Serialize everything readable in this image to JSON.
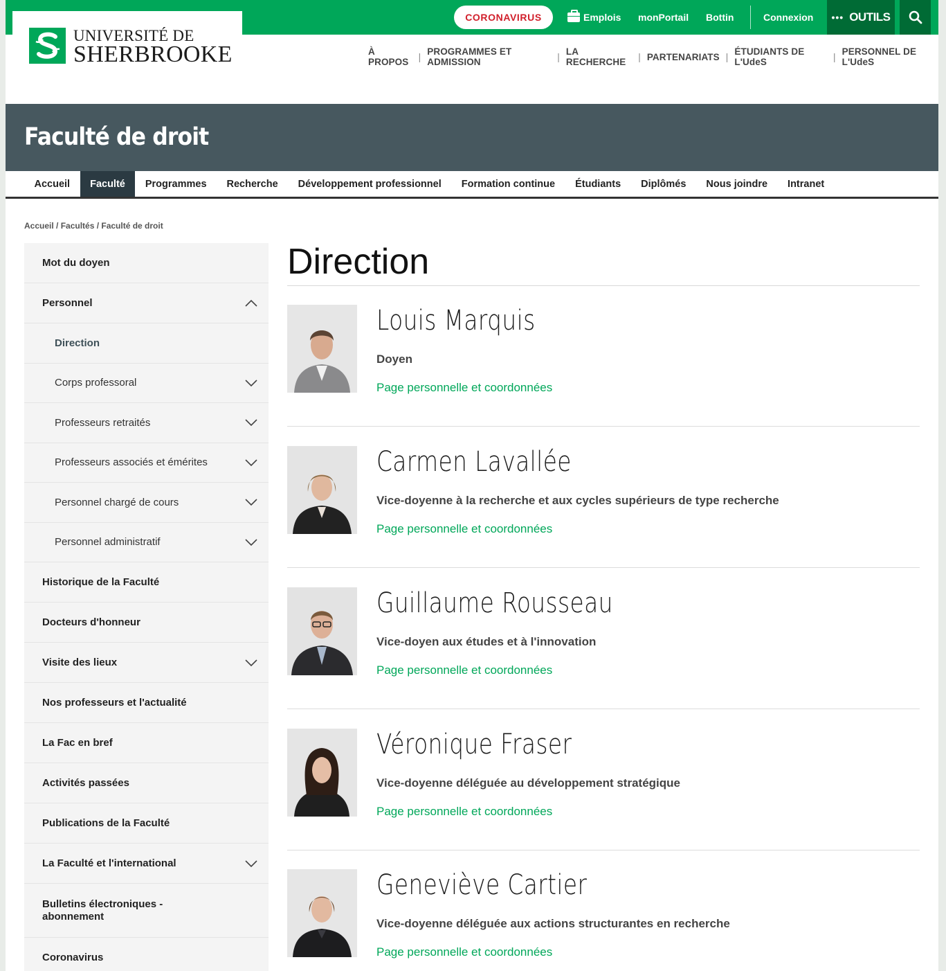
{
  "header": {
    "logo": {
      "line1": "UNIVERSITÉ DE",
      "line2": "SHERBROOKE"
    },
    "coronavirus_label": "CORONAVIRUS",
    "top_links": [
      "Emplois",
      "monPortail",
      "Bottin",
      "Connexion"
    ],
    "outils_label": "OUTILS",
    "main_nav": [
      "À PROPOS",
      "PROGRAMMES ET ADMISSION",
      "LA RECHERCHE",
      "PARTENARIATS",
      "ÉTUDIANTS DE L'UdeS",
      "PERSONNEL DE L'UdeS"
    ],
    "nav_separator": "|"
  },
  "banner": {
    "title": "Faculté de droit"
  },
  "subnav": {
    "items": [
      "Accueil",
      "Faculté",
      "Programmes",
      "Recherche",
      "Développement professionnel",
      "Formation continue",
      "Étudiants",
      "Diplômés",
      "Nous joindre",
      "Intranet"
    ],
    "active": "Faculté"
  },
  "breadcrumb": "Accueil / Facultés / Faculté de droit",
  "sidebar": {
    "items": [
      {
        "label": "Mot du doyen"
      },
      {
        "label": "Personnel"
      },
      {
        "label": "Direction"
      },
      {
        "label": "Corps professoral"
      },
      {
        "label": "Professeurs retraités"
      },
      {
        "label": "Professeurs associés et émérites"
      },
      {
        "label": "Personnel chargé de cours"
      },
      {
        "label": "Personnel administratif"
      },
      {
        "label": "Historique de la Faculté"
      },
      {
        "label": "Docteurs d'honneur"
      },
      {
        "label": "Visite des lieux"
      },
      {
        "label": "Nos professeurs et l'actualité"
      },
      {
        "label": "La Fac en bref"
      },
      {
        "label": "Activités passées"
      },
      {
        "label": "Publications de la Faculté"
      },
      {
        "label": "La Faculté et l'international"
      },
      {
        "label": "Bulletins électroniques - abonnement"
      },
      {
        "label": "Coronavirus"
      }
    ]
  },
  "content": {
    "title": "Direction",
    "link_label": "Page personnelle et coordonnées",
    "people": [
      {
        "name": "Louis Marquis",
        "role": "Doyen"
      },
      {
        "name": "Carmen Lavallée",
        "role": "Vice-doyenne à la recherche et aux cycles supérieurs de type recherche"
      },
      {
        "name": "Guillaume Rousseau",
        "role": "Vice-doyen aux études et à l'innovation"
      },
      {
        "name": "Véronique Fraser",
        "role": "Vice-doyenne déléguée au développement stratégique"
      },
      {
        "name": "Geneviève Cartier",
        "role": "Vice-doyenne déléguée aux actions structurantes en recherche"
      }
    ]
  },
  "colors": {
    "brand_green": "#00a759",
    "dark_green": "#006b35",
    "banner": "#47585f",
    "active_tab": "#2b3a42",
    "covid_red": "#d11f2b"
  }
}
